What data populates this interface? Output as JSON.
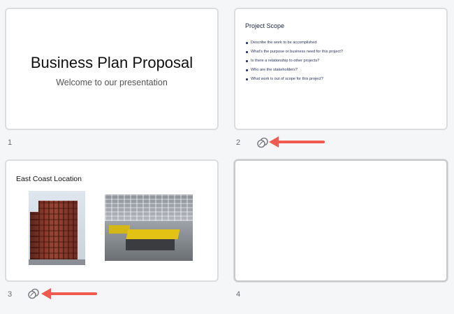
{
  "slides": [
    {
      "number": "1",
      "title": "Business Plan Proposal",
      "subtitle": "Welcome to our presentation"
    },
    {
      "number": "2",
      "title": "Project Scope",
      "bullets": [
        "Describe the work to be accomplished",
        "What's the purpose or business need for this project?",
        "Is there a relationship to other projects?",
        "Who are the stakeholders?",
        "What work is out of scope for this project?"
      ],
      "linked_icon": "linked-circles-icon"
    },
    {
      "number": "3",
      "title": "East Coast Location",
      "images": [
        "building-photo",
        "office-photo"
      ],
      "linked_icon": "linked-circles-icon"
    },
    {
      "number": "4"
    }
  ],
  "colors": {
    "background": "#f5f6f8",
    "annotation_arrow": "#f05a4f",
    "bullet_text": "#2a3560"
  }
}
